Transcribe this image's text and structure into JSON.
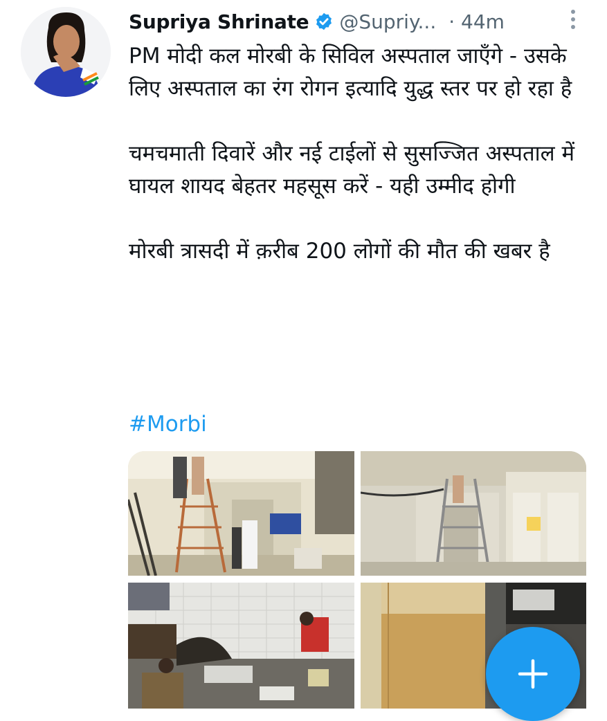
{
  "tweet": {
    "author_name": "Supriya Shrinate",
    "handle": "@Supriy...",
    "separator": "·",
    "time": "44m",
    "paragraphs": [
      "PM मोदी कल मोरबी के सिविल अस्पताल जाएँगे - उसके लिए अस्पताल का रंग रोगन इत्यादि युद्ध स्तर पर हो रहा है",
      "चमचमाती दिवारें और नई टाईलों से सुसज्जित अस्पताल में घायल शायद बेहतर महसूस करें - यही उम्मीद होगी",
      "मोरबी त्रासदी में क़रीब 200 लोगों की मौत की खबर है"
    ],
    "hashtag": "#Morbi"
  },
  "icons": {
    "verified": "verified-badge-icon",
    "more": "more-vertical-icon",
    "compose": "plus-icon"
  },
  "colors": {
    "accent": "#1d9bf0",
    "text": "#0f1419",
    "secondary_text": "#536471",
    "background": "#ffffff"
  }
}
